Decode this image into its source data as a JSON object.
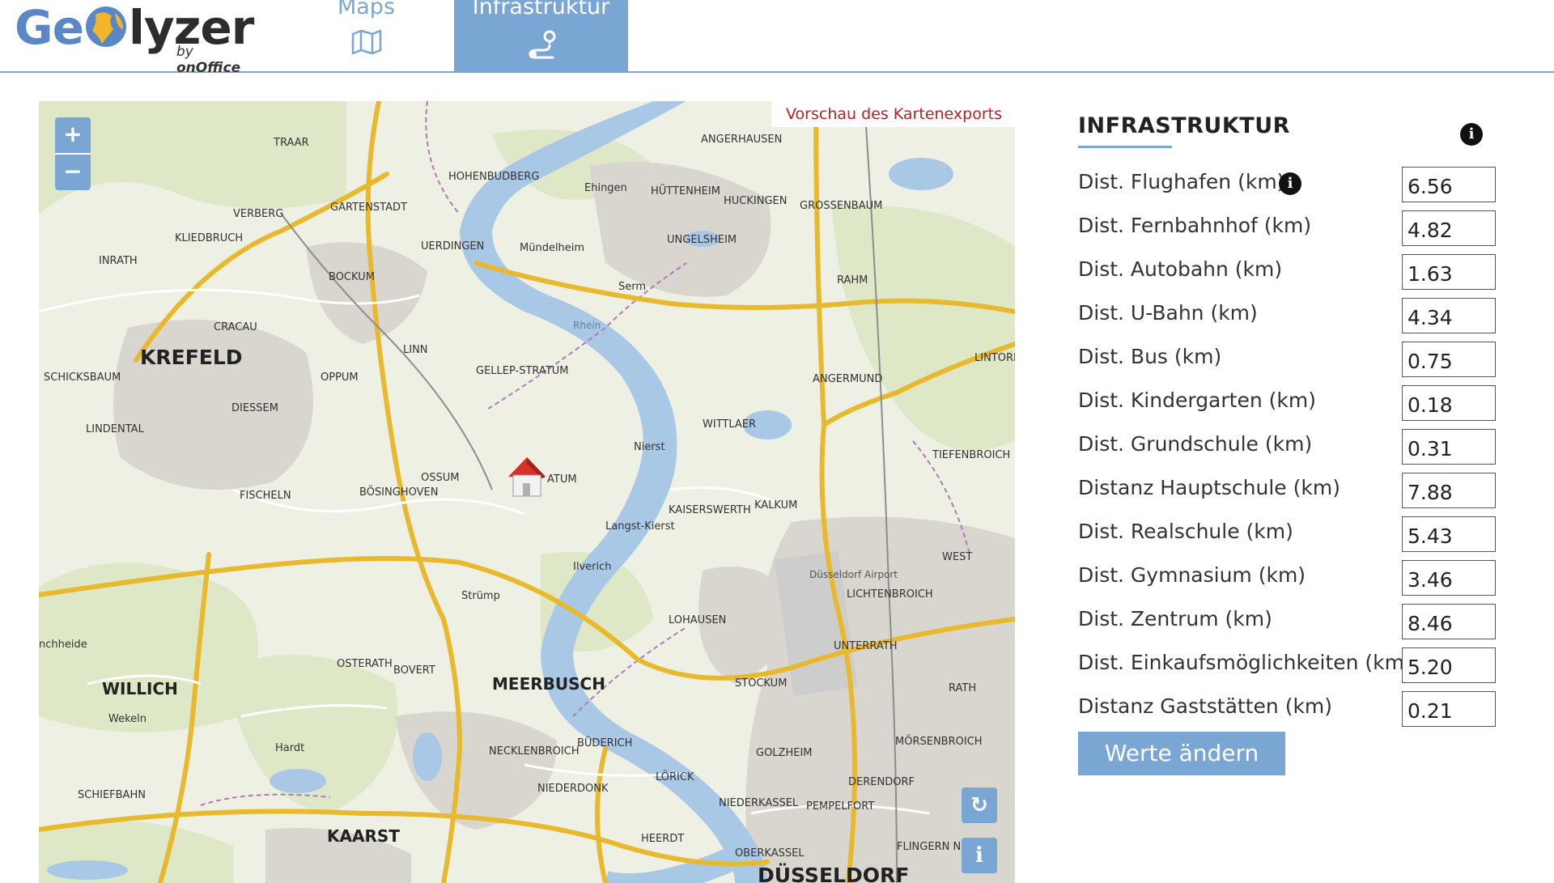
{
  "header": {
    "logo": {
      "part1": "Ge",
      "part2": "lyzer",
      "byline_prefix": "by ",
      "byline_brand": "onOffice"
    },
    "tabs": [
      {
        "label": "Maps",
        "icon": "map-icon",
        "active": false
      },
      {
        "label": "Infrastruktur",
        "icon": "route-icon",
        "active": true
      }
    ]
  },
  "colors": {
    "accent": "#7aa6d3",
    "preview_text": "#b0232a"
  },
  "map": {
    "preview_label": "Vorschau des Kartenexports",
    "zoom_in": "+",
    "zoom_out": "−",
    "reset_icon": "↻",
    "info_icon": "i",
    "places": {
      "krefeld": "KREFELD",
      "meerbusch": "MEERBUSCH",
      "willich": "WILLICH",
      "kaarst": "KAARST",
      "duesseldorf": "DÜSSELDORF",
      "traar": "TRAAR",
      "verberg": "VERBERG",
      "kliedbruch": "KLIEDBRUCH",
      "inrath": "INRATH",
      "cracau": "CRACAU",
      "schicksbaum": "SCHICKSBAUM",
      "lindental": "LINDENTAL",
      "diessem": "DIESSEM",
      "fischeln": "FISCHELN",
      "gartenstadt": "GARTENSTADT",
      "bockum": "BOCKUM",
      "uerdingen": "UERDINGEN",
      "hohenbudberg": "HOHENBUDBERG",
      "linn": "LINN",
      "oppum": "OPPUM",
      "gellep_stratum": "GELLEP-STRATUM",
      "ossum": "OSSUM",
      "boesinghoven": "BÖSINGHOVEN",
      "atum": "ATUM",
      "nierst": "Nierst",
      "langst_kierst": "Langst-Kierst",
      "ilverich": "Ilverich",
      "strump": "Strümp",
      "osterath": "OSTERATH",
      "bovert": "BOVERT",
      "wekeln": "Wekeln",
      "hardt": "Hardt",
      "schiefbahn": "SCHIEFBAHN",
      "necklenbroich": "NECKLENBROICH",
      "buederich": "BÜDERICH",
      "niederdonk": "NIEDERDONK",
      "loerick": "LÖRICK",
      "lohausen": "LOHAUSEN",
      "stockum": "STOCKUM",
      "kaiserswerth": "KAISERSWERTH",
      "kalkum": "KALKUM",
      "wittlaer": "WITTLAER",
      "angermund": "ANGERMUND",
      "serm": "Serm",
      "muendelheim": "Mündelheim",
      "ehingen": "Ehingen",
      "huettenheim": "HÜTTENHEIM",
      "huckingen": "HUCKINGEN",
      "grossenbaum": "GROSSENBAUM",
      "ungelsheim": "UNGELSHEIM",
      "angerhausen": "ANGERHAUSEN",
      "rahm": "RAHM",
      "lichtenbroich": "LICHTENBROICH",
      "unterrath": "UNTERRATH",
      "rath": "RATH",
      "moersenbroich": "MÖRSENBROICH",
      "derendorf": "DERENDORF",
      "golzheim": "GOLZHEIM",
      "niederkassel": "NIEDERKASSEL",
      "pempelfort": "PEMPELFORT",
      "oberkassel": "OBERKASSEL",
      "heerdt": "HEERDT",
      "flingern": "FLINGERN NORD",
      "west": "WEST",
      "tiefenbroich": "TIEFENBROICH",
      "lintorf": "LINTORF",
      "airport": "Düsseldorf Airport",
      "rhein": "Rhein",
      "anchheide": "nchheide"
    }
  },
  "panel": {
    "title": "INFRASTRUKTUR",
    "rows": [
      {
        "label": "Dist. Flughafen (km)",
        "value": "6.56",
        "has_info": true
      },
      {
        "label": "Dist. Fernbahnhof (km)",
        "value": "4.82",
        "has_info": false
      },
      {
        "label": "Dist. Autobahn (km)",
        "value": "1.63",
        "has_info": false
      },
      {
        "label": "Dist. U-Bahn (km)",
        "value": "4.34",
        "has_info": false
      },
      {
        "label": "Dist. Bus (km)",
        "value": "0.75",
        "has_info": false
      },
      {
        "label": "Dist. Kindergarten (km)",
        "value": "0.18",
        "has_info": false
      },
      {
        "label": "Dist. Grundschule (km)",
        "value": "0.31",
        "has_info": false
      },
      {
        "label": "Distanz Hauptschule (km)",
        "value": "7.88",
        "has_info": false
      },
      {
        "label": "Dist. Realschule (km)",
        "value": "5.43",
        "has_info": false
      },
      {
        "label": "Dist. Gymnasium (km)",
        "value": "3.46",
        "has_info": false
      },
      {
        "label": "Dist. Zentrum (km)",
        "value": "8.46",
        "has_info": false
      },
      {
        "label": "Dist. Einkaufsmöglichkeiten (km)",
        "value": "5.20",
        "has_info": false
      },
      {
        "label": "Distanz Gaststätten (km)",
        "value": "0.21",
        "has_info": false
      }
    ],
    "submit_label": "Werte ändern"
  }
}
